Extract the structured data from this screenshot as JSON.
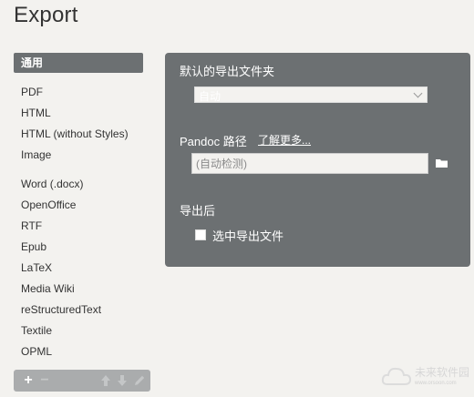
{
  "window": {
    "title": "Export"
  },
  "sidebar": {
    "group_header": "通用",
    "items": [
      {
        "label": "PDF"
      },
      {
        "label": "HTML"
      },
      {
        "label": "HTML (without Styles)"
      },
      {
        "label": "Image"
      },
      {
        "label": "Word (.docx)"
      },
      {
        "label": "OpenOffice"
      },
      {
        "label": "RTF"
      },
      {
        "label": "Epub"
      },
      {
        "label": "LaTeX"
      },
      {
        "label": "Media Wiki"
      },
      {
        "label": "reStructuredText"
      },
      {
        "label": "Textile"
      },
      {
        "label": "OPML"
      }
    ],
    "toolbar": {
      "add_icon": "plus-icon",
      "remove_icon": "minus-icon",
      "move_up_icon": "arrow-up-icon",
      "move_down_icon": "arrow-down-icon",
      "edit_icon": "pencil-icon"
    }
  },
  "panel": {
    "default_folder_label": "默认的导出文件夹",
    "default_folder_value": "自动",
    "pandoc_label": "Pandoc 路径",
    "pandoc_learn_more": "了解更多...",
    "pandoc_placeholder": "(自动检测)",
    "after_export_label": "导出后",
    "select_file_label": "选中导出文件",
    "select_file_checked": false
  },
  "watermark": {
    "text": "未来软件园",
    "sub": "www.orsoon.com"
  },
  "colors": {
    "panel": "#6c7072",
    "background": "#f3f2ef",
    "toolbar": "#aaacad"
  }
}
